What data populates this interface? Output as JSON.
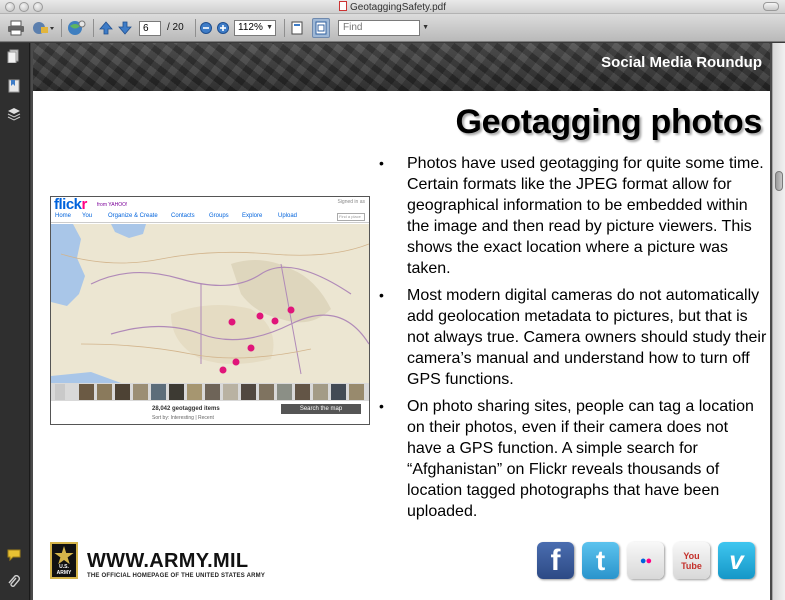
{
  "window": {
    "title": "GeotaggingSafety.pdf"
  },
  "toolbar": {
    "current_page": "6",
    "total_pages": "/ 20",
    "zoom": "112%",
    "find_placeholder": "Find",
    "icons": [
      "print-icon",
      "share-icon",
      "collaborate-icon",
      "previous-page-icon",
      "next-page-icon",
      "zoom-out-icon",
      "zoom-in-icon",
      "fit-page-icon",
      "full-screen-icon"
    ]
  },
  "sidebar": {
    "icons": [
      "pages-icon",
      "bookmarks-icon",
      "layers-icon",
      "comments-icon",
      "attachments-icon"
    ]
  },
  "slide": {
    "header": "Social Media Roundup",
    "title": "Geotagging photos",
    "bullets": [
      "Photos have used geotagging for quite some time. Certain formats like the JPEG format allow for geographical information to be embedded within the image and then read by picture viewers. This shows the exact location where a picture was taken.",
      "Most modern digital cameras do not automatically add geolocation metadata to pictures, but that is not always true. Camera owners should study their camera’s manual and understand how to turn off GPS functions.",
      "On photo sharing sites, people can tag a location on their photos, even if their camera does not have a GPS function. A simple search for “Afghanistan” on Flickr reveals thousands of location tagged photographs that have been uploaded."
    ],
    "flickr": {
      "logo_a": "flick",
      "logo_b": "r",
      "yahoo": "from YAHOO!",
      "signin": "Signed in as",
      "nav": [
        "Home",
        "You",
        "Organize & Create",
        "Contacts",
        "Groups",
        "Explore",
        "Upload"
      ],
      "search_placeholder": "Find a place",
      "count": "28,042 geotagged items",
      "sort": "Sort by: Interesting | Recent",
      "search_button": "Search the map"
    },
    "footer": {
      "army_badge": "U.S. ARMY",
      "url": "WWW.ARMY.MIL",
      "tagline": "THE OFFICIAL HOMEPAGE OF THE UNITED STATES ARMY"
    },
    "social": [
      {
        "name": "facebook",
        "glyph": "f",
        "color": "#3b5998"
      },
      {
        "name": "twitter",
        "glyph": "t",
        "color": "#33aadd"
      },
      {
        "name": "flickr",
        "glyph": "●●",
        "color": "#e8e8e8"
      },
      {
        "name": "youtube",
        "glyph": "You Tube",
        "color": "#f1f1f1"
      },
      {
        "name": "vimeo",
        "glyph": "v",
        "color": "#1ab7ea"
      }
    ]
  }
}
